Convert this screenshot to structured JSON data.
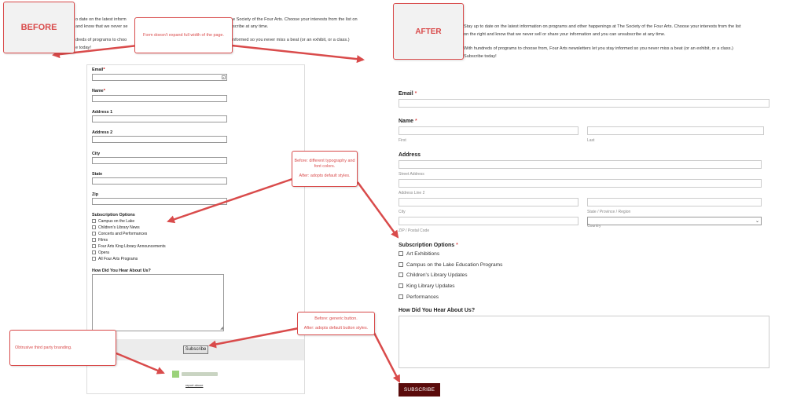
{
  "tags": {
    "before": "BEFORE",
    "after": "AFTER"
  },
  "notes": {
    "width": "Form doesn't expand full width of the page.",
    "typography": [
      "Before: different typography and font colors.",
      "After: adopts default styles."
    ],
    "button": [
      "Before: generic button.",
      "After: adopts default button styles."
    ],
    "branding": "Obtrusive third party branding."
  },
  "before": {
    "intro": [
      "o date on the latest inform",
      "and know that we never se",
      "dreds of programs to choo",
      "e today!"
    ],
    "intro_right": [
      "e Society of the Four Arts. Choose your interests from the list on",
      "scribe at any time.",
      "nformed so you never miss a beat (or an exhibit, or a class.)"
    ],
    "fields": {
      "email": "Email",
      "name": "Name",
      "address1": "Address 1",
      "address2": "Address 2",
      "city": "City",
      "state": "State",
      "zip": "Zip"
    },
    "required_mark": "*",
    "subscription_title": "Subscription Options",
    "options": [
      "Campus on the Lake",
      "Children's Library News",
      "Concerts and Performances",
      "Films",
      "Four Arts King Library Announcements",
      "Opera",
      "All Four Arts Programs"
    ],
    "hear_label": "How Did You Hear About Us?",
    "subscribe_label": "Subscribe",
    "report_abuse": "report abuse"
  },
  "after": {
    "intro": [
      "Stay up to date on the latest information on programs and other happenings at The Society of the Four Arts. Choose your interests from the list",
      "on the right and know that we never sell or share your information and you can unsubscribe at any time.",
      "With hundreds of programs to choose from, Four Arts newsletters let you stay informed so you never miss a beat (or an exhibit, or a class.)",
      "Subscribe today!"
    ],
    "email_label": "Email",
    "name_label": "Name",
    "required_mark": "*",
    "first": "First",
    "last": "Last",
    "address_label": "Address",
    "street": "Street Address",
    "line2": "Address Line 2",
    "city": "City",
    "state": "State / Province / Region",
    "zip": "ZIP / Postal Code",
    "country": "Country",
    "subscription_title": "Subscription Options",
    "options": [
      "Art Exhibitions",
      "Campus on the Lake Education Programs",
      "Children's Library Updates",
      "King Library Updates",
      "Performances"
    ],
    "hear_label": "How Did You Hear About Us?",
    "subscribe_label": "SUBSCRIBE"
  },
  "colors": {
    "accent": "#d94b4b",
    "button_after": "#5a0b0b"
  }
}
